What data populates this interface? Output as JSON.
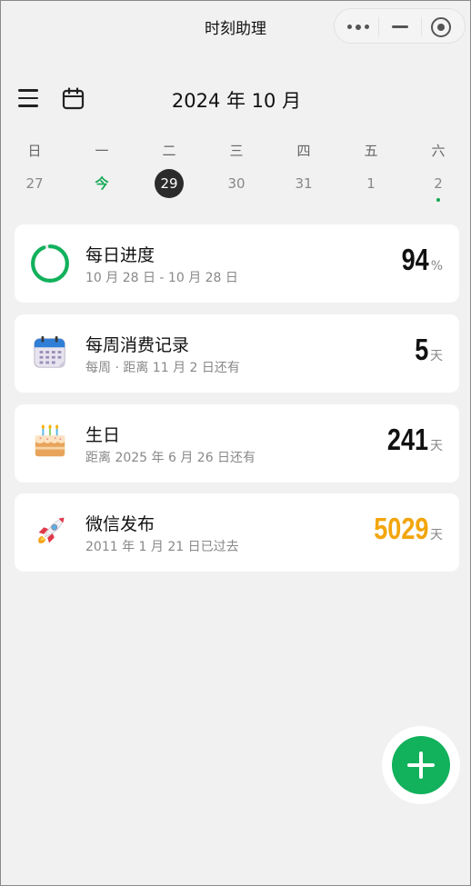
{
  "app": {
    "title": "时刻助理"
  },
  "header": {
    "month_title": "2024 年 10 月"
  },
  "week": {
    "days": [
      {
        "weekday": "日",
        "date": "27"
      },
      {
        "weekday": "一",
        "date": "今"
      },
      {
        "weekday": "二",
        "date": "29"
      },
      {
        "weekday": "三",
        "date": "30"
      },
      {
        "weekday": "四",
        "date": "31"
      },
      {
        "weekday": "五",
        "date": "1"
      },
      {
        "weekday": "六",
        "date": "2"
      }
    ]
  },
  "cards": [
    {
      "title": "每日进度",
      "subtitle": "10 月 28 日 - 10 月 28 日",
      "value": "94",
      "unit": "%",
      "icon": "progress-ring-icon",
      "progress": 0.94
    },
    {
      "title": "每周消费记录",
      "subtitle": "每周 · 距离 11 月 2 日还有",
      "value": "5",
      "unit": "天",
      "icon": "calendar-icon"
    },
    {
      "title": "生日",
      "subtitle": "距离 2025 年 6 月 26 日还有",
      "value": "241",
      "unit": "天",
      "icon": "birthday-cake-icon"
    },
    {
      "title": "微信发布",
      "subtitle": "2011 年 1 月 21 日已过去",
      "value": "5029",
      "unit": "天",
      "icon": "rocket-icon"
    }
  ],
  "colors": {
    "accent": "#12b15c",
    "highlight_value": "#f2a50c",
    "selected_day": "#2b2b2b"
  }
}
